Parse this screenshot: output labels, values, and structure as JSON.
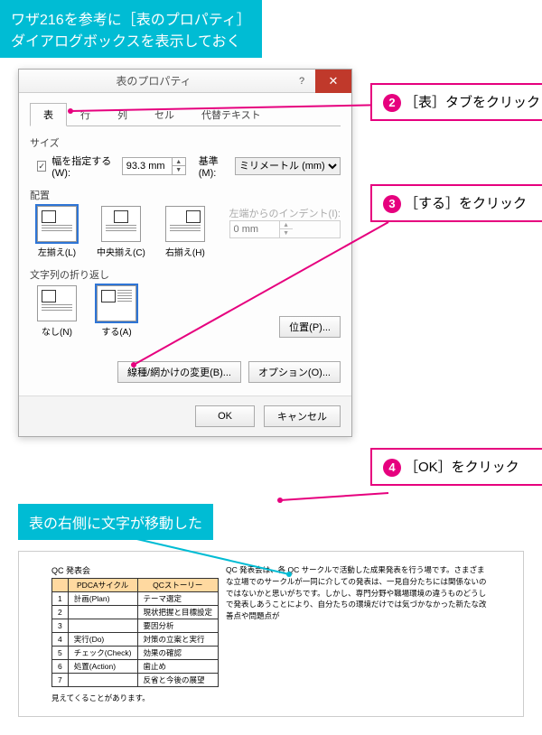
{
  "notes": {
    "top": "ワザ216を参考に［表のプロパティ］\nダイアログボックスを表示しておく",
    "result": "表の右側に文字が移動した"
  },
  "callouts": {
    "c2": "［表］タブをクリック",
    "c3": "［する］をクリック",
    "c4": "［OK］をクリック"
  },
  "dialog": {
    "title": "表のプロパティ",
    "tabs": {
      "t1": "表",
      "t2": "行",
      "t3": "列",
      "t4": "セル",
      "t5": "代替テキスト"
    },
    "size_label": "サイズ",
    "width_chk": "幅を指定する(W):",
    "width_val": "93.3 mm",
    "measure_lbl": "基準(M):",
    "measure_val": "ミリメートル (mm)",
    "align_label": "配置",
    "align": {
      "left": "左揃え(L)",
      "center": "中央揃え(C)",
      "right": "右揃え(H)"
    },
    "indent_lbl": "左端からのインデント(I):",
    "indent_val": "0 mm",
    "wrap_label": "文字列の折り返し",
    "wrap": {
      "none": "なし(N)",
      "around": "する(A)"
    },
    "pos_btn": "位置(P)...",
    "border_btn": "線種/網かけの変更(B)...",
    "option_btn": "オプション(O)...",
    "ok": "OK",
    "cancel": "キャンセル"
  },
  "preview": {
    "title": "QC 発表会",
    "headers": {
      "h1": "PDCAサイクル",
      "h2": "QCストーリー"
    },
    "rows": [
      {
        "n": "1",
        "a": "計画(Plan)",
        "b": "テーマ選定"
      },
      {
        "n": "2",
        "a": "",
        "b": "現状把握と目標設定"
      },
      {
        "n": "3",
        "a": "",
        "b": "要因分析"
      },
      {
        "n": "4",
        "a": "実行(Do)",
        "b": "対策の立案と実行"
      },
      {
        "n": "5",
        "a": "チェック(Check)",
        "b": "効果の確認"
      },
      {
        "n": "6",
        "a": "処置(Action)",
        "b": "歯止め"
      },
      {
        "n": "7",
        "a": "",
        "b": "反省と今後の展望"
      }
    ],
    "foot": "見えてくることがあります。",
    "body": "QC 発表会は、各 QC サークルで活動した成果発表を行う場です。さまざまな立場でのサークルが一同に介しての発表は、一見自分たちには関係ないのではないかと思いがちです。しかし、専門分野や職場環境の違うものどうしで発表しあうことにより、自分たちの環境だけでは気づかなかった新たな改善点や問題点が"
  }
}
